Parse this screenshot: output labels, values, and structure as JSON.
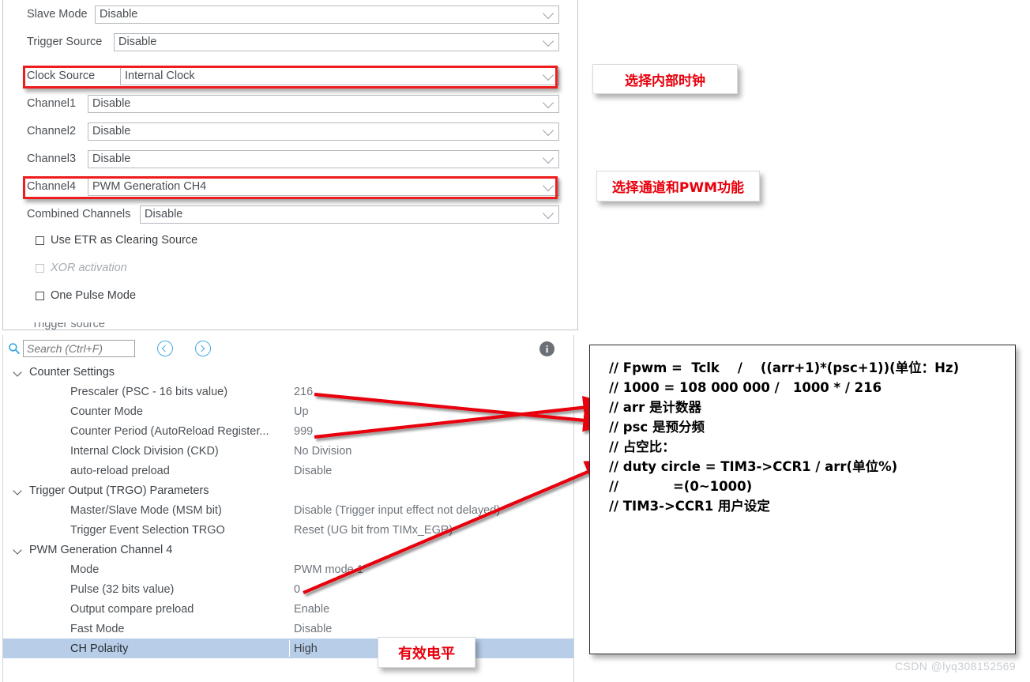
{
  "colors": {
    "accent_red": "#ee1c1c",
    "note_text_red": "#e8000d",
    "selection_blue": "#b7cde8",
    "nav_icon_blue": "#4aa8e0",
    "label_gray": "#4a4f54",
    "value_gray": "#6f757b"
  },
  "config_panel": {
    "rows": [
      {
        "label": "Slave Mode",
        "value": "Disable",
        "label_w": 80,
        "highlight": false
      },
      {
        "label": "Trigger Source",
        "value": "Disable",
        "label_w": 104,
        "highlight": false
      },
      {
        "label": "Clock Source",
        "value": "Internal Clock",
        "label_w": 112,
        "highlight": true
      },
      {
        "label": "Channel1",
        "value": "Disable",
        "label_w": 71,
        "highlight": false
      },
      {
        "label": "Channel2",
        "value": "Disable",
        "label_w": 71,
        "highlight": false
      },
      {
        "label": "Channel3",
        "value": "Disable",
        "label_w": 71,
        "highlight": false
      },
      {
        "label": "Channel4",
        "value": "PWM Generation CH4",
        "label_w": 71,
        "highlight": true
      },
      {
        "label": "Combined Channels",
        "value": "Disable",
        "label_w": 137,
        "highlight": false
      }
    ],
    "checkboxes": [
      {
        "label": "Use ETR as Clearing Source",
        "checked": false,
        "enabled": true
      },
      {
        "label": "XOR activation",
        "checked": false,
        "enabled": false
      },
      {
        "label": "One Pulse Mode",
        "checked": false,
        "enabled": true
      }
    ],
    "clipped_row_label": "Trigger source"
  },
  "search_bar": {
    "icon": "search-icon",
    "placeholder": "Search (Ctrl+F)",
    "value": "",
    "prev_icon": "chevron-left-circle-icon",
    "next_icon": "chevron-right-circle-icon",
    "info_icon": "info-icon",
    "info_glyph": "i"
  },
  "tree": [
    {
      "type": "group",
      "label": "Counter Settings",
      "expanded": true
    },
    {
      "type": "item",
      "label": "Prescaler (PSC - 16 bits value)",
      "value": "216"
    },
    {
      "type": "item",
      "label": "Counter Mode",
      "value": "Up"
    },
    {
      "type": "item",
      "label": "Counter Period (AutoReload Register...",
      "value": "999"
    },
    {
      "type": "item",
      "label": "Internal Clock Division (CKD)",
      "value": "No Division"
    },
    {
      "type": "item",
      "label": "auto-reload preload",
      "value": "Disable"
    },
    {
      "type": "group",
      "label": "Trigger Output (TRGO) Parameters",
      "expanded": true
    },
    {
      "type": "item",
      "label": "Master/Slave Mode (MSM bit)",
      "value": "Disable (Trigger input effect not delayed)"
    },
    {
      "type": "item",
      "label": "Trigger Event Selection TRGO",
      "value": "Reset (UG bit from TIMx_EGR)"
    },
    {
      "type": "group",
      "label": "PWM Generation Channel 4",
      "expanded": true
    },
    {
      "type": "item",
      "label": "Mode",
      "value": "PWM mode 1"
    },
    {
      "type": "item",
      "label": "Pulse (32 bits value)",
      "value": "0"
    },
    {
      "type": "item",
      "label": "Output compare preload",
      "value": "Enable"
    },
    {
      "type": "item",
      "label": "Fast Mode",
      "value": "Disable"
    },
    {
      "type": "item",
      "label": "CH Polarity",
      "value": "High",
      "selected": true
    }
  ],
  "annotations": {
    "clock_source": "选择内部时钟",
    "channel_pwm": "选择通道和PWM功能",
    "ch_polarity": "有效电平"
  },
  "code_note": {
    "lines": [
      "// Fpwm =  Tclk    /    ((arr+1)*(psc+1))(单位：Hz)",
      "// 1000 = 108 000 000 /   1000 * / 216",
      "// arr 是计数器",
      "// psc 是预分频",
      "// 占空比：",
      "// duty circle = TIM3->CCR1 / arr(单位%)",
      "//            =(0~1000)",
      "// TIM3->CCR1 用户设定"
    ]
  },
  "watermark": "CSDN @lyq308152569"
}
